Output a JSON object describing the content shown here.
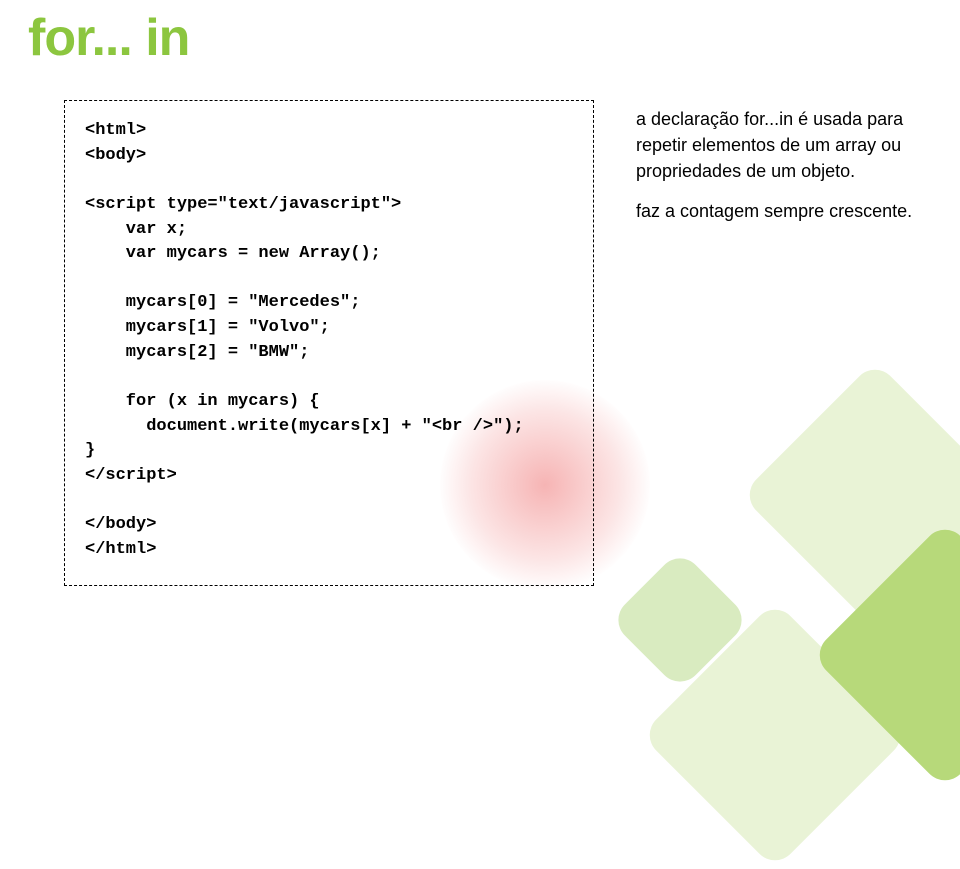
{
  "title": "for... in",
  "code": "<html>\n<body>\n\n<script type=\"text/javascript\">\n    var x;\n    var mycars = new Array();\n\n    mycars[0] = \"Mercedes\";\n    mycars[1] = \"Volvo\";\n    mycars[2] = \"BMW\";\n\n    for (x in mycars) {\n      document.write(mycars[x] + \"<br />\");\n}\n</script>\n\n</body>\n</html>",
  "desc": {
    "p1": "a declaração for...in é usada para repetir elementos de um array ou propriedades de um objeto.",
    "p2": "faz a contagem sempre crescente."
  }
}
